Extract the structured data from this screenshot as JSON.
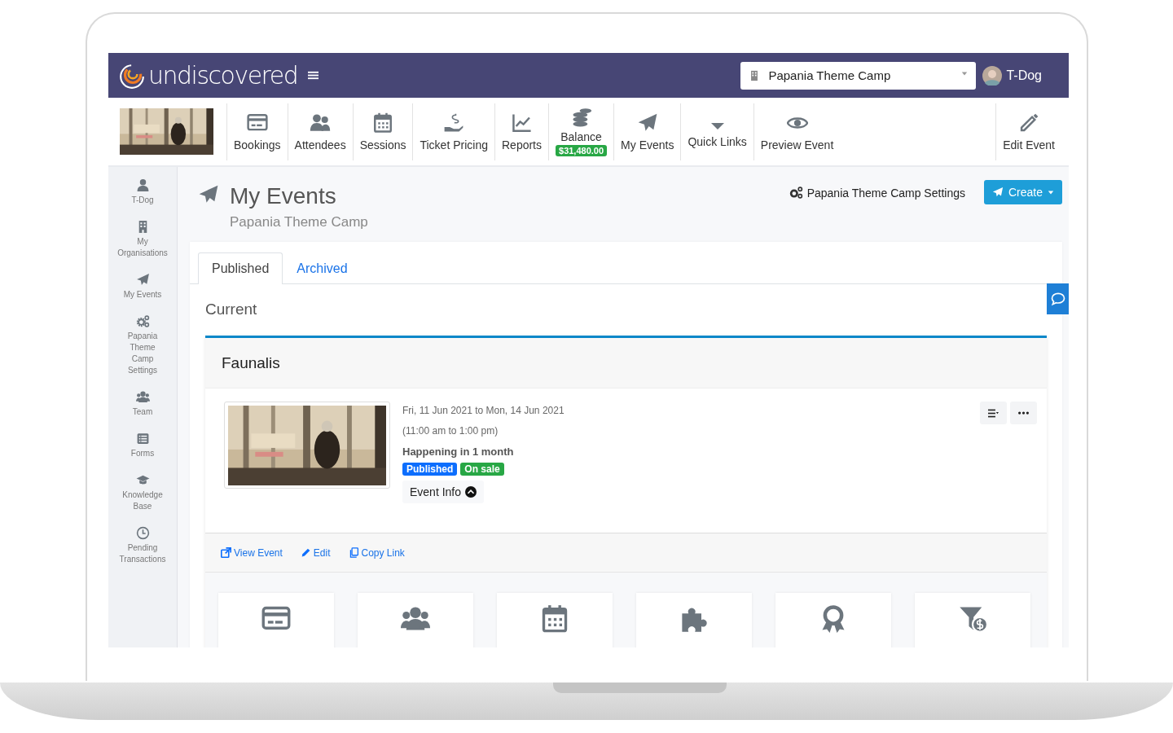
{
  "header": {
    "brand": "undiscovered",
    "org_select": {
      "value": "Papania Theme Camp"
    },
    "user": {
      "name": "T-Dog"
    }
  },
  "toolbar": {
    "items": [
      {
        "kind": "link",
        "label": "Bookings"
      },
      {
        "kind": "link",
        "label": "Attendees"
      },
      {
        "kind": "link",
        "label": "Sessions"
      },
      {
        "kind": "link",
        "label": "Ticket Pricing"
      },
      {
        "kind": "link",
        "label": "Reports"
      },
      {
        "kind": "balance",
        "label": "Balance",
        "badge": "$31,480.00"
      },
      {
        "kind": "link",
        "label": "My Events"
      },
      {
        "kind": "link",
        "label": "Quick Links"
      },
      {
        "kind": "link",
        "label": "Preview Event"
      }
    ],
    "edit_button": "Edit Event"
  },
  "sidebar": {
    "items": [
      {
        "label": "T-Dog"
      },
      {
        "label": "My Organisations"
      },
      {
        "label": "My Events"
      },
      {
        "label": "Papania Theme Camp Settings"
      },
      {
        "label": "Team"
      },
      {
        "label": "Forms"
      },
      {
        "label": "Knowledge Base"
      },
      {
        "label": "Pending Transactions"
      }
    ]
  },
  "page": {
    "title": "My Events",
    "subtitle": "Papania Theme Camp",
    "settings_link": "Papania Theme Camp Settings",
    "create_button": "Create"
  },
  "tabs": [
    {
      "label": "Published",
      "selected": true
    },
    {
      "label": "Archived",
      "selected": false
    }
  ],
  "section_title": "Current",
  "event": {
    "name": "Faunalis",
    "date_range": "Fri, 11 Jun 2021 to Mon, 14 Jun 2021",
    "time_range": "(11:00 am to 1:00 pm)",
    "relative": "Happening in 1 month",
    "badges": [
      {
        "label": "Published",
        "color": "#0d6efd"
      },
      {
        "label": "On sale",
        "color": "#28a745"
      }
    ],
    "info_button": "Event Info",
    "links": [
      "View Event",
      "Edit",
      "Copy Link"
    ]
  }
}
